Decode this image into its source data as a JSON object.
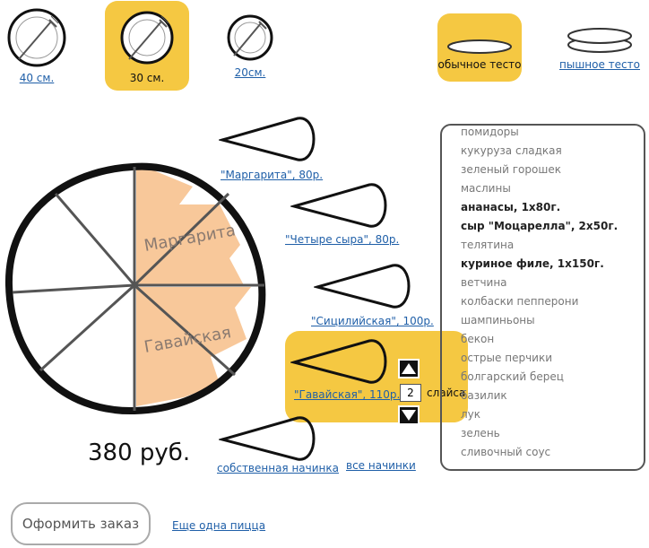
{
  "sizes": [
    {
      "label": "40 см."
    },
    {
      "label": "30 см."
    },
    {
      "label": "20см."
    }
  ],
  "crust": {
    "regular": "обычное тесто",
    "fluffy": "пышное тесто"
  },
  "pizza": {
    "top_slice_label": "Маргарита",
    "bottom_slice_label": "Гавайская",
    "price": "380 руб."
  },
  "slots": [
    {
      "label": "\"Маргарита\", 80р."
    },
    {
      "label": "\"Четыре сыра\", 80р."
    },
    {
      "label": "\"Сицилийская\", 100р."
    },
    {
      "label": "\"Гавайская\", 110р."
    }
  ],
  "spinner": {
    "value": "2",
    "unit": "слайса"
  },
  "custom_filling": "собственная начинка",
  "all_fillings": "все начинки",
  "ingredients": [
    {
      "label": "помидоры",
      "selected": false
    },
    {
      "label": "кукуруза сладкая",
      "selected": false
    },
    {
      "label": "зеленый горошек",
      "selected": false
    },
    {
      "label": "маслины",
      "selected": false
    },
    {
      "label": "ананасы, 1х80г.",
      "selected": true
    },
    {
      "label": "сыр \"Моцарелла\", 2х50г.",
      "selected": true
    },
    {
      "label": "телятина",
      "selected": false
    },
    {
      "label": "куриное филе, 1х150г.",
      "selected": true
    },
    {
      "label": "ветчина",
      "selected": false
    },
    {
      "label": "колбаски пепперони",
      "selected": false
    },
    {
      "label": "шампиньоны",
      "selected": false
    },
    {
      "label": "бекон",
      "selected": false
    },
    {
      "label": "острые перчики",
      "selected": false
    },
    {
      "label": "болгарский берец",
      "selected": false
    },
    {
      "label": "базилик",
      "selected": false
    },
    {
      "label": "лук",
      "selected": false
    },
    {
      "label": "зелень",
      "selected": false
    },
    {
      "label": "сливочный соус",
      "selected": false
    }
  ],
  "order_button": "Оформить заказ",
  "another_pizza": "Еще одна пицца",
  "colors": {
    "accent": "#f5c842",
    "topping": "#f8c89a",
    "link": "#1f5fa8"
  }
}
